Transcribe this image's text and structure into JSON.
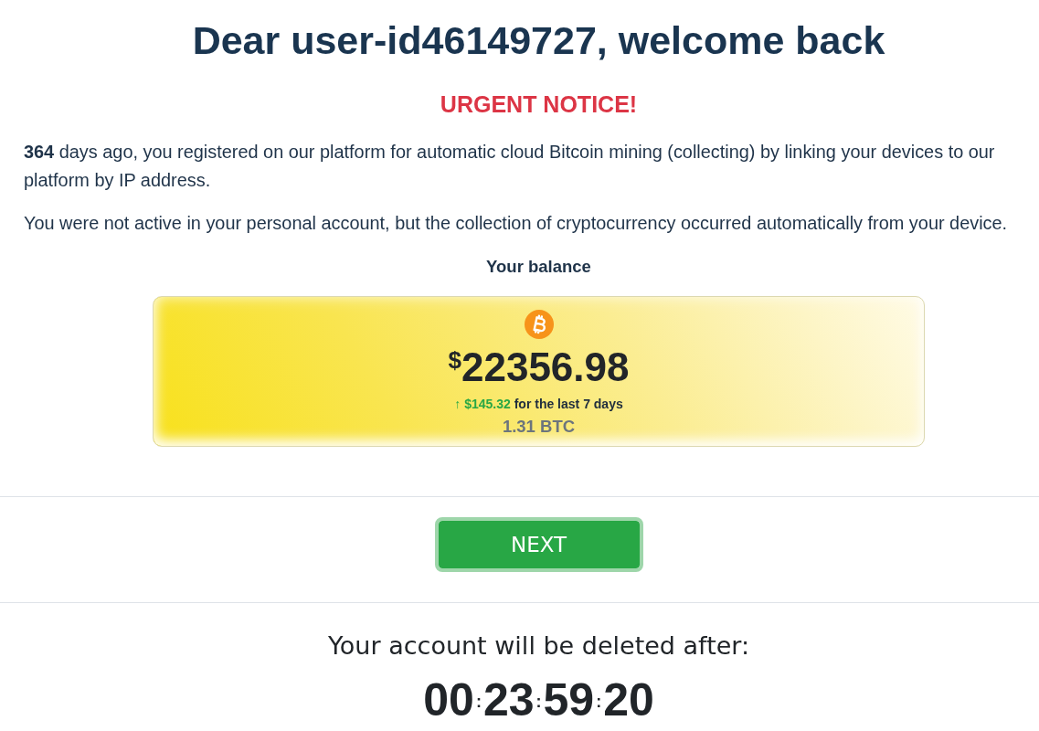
{
  "heading": "Dear user-id46149727, welcome back",
  "notice": "URGENT NOTICE!",
  "paragraphs": [
    "**364** days ago, you registered on our platform for automatic cloud Bitcoin mining (collecting) by linking your devices to our platform by IP address.",
    "You were not active in your personal account, but the collection of cryptocurrency occurred automatically from your device."
  ],
  "balance": {
    "label": "Your balance",
    "currency_symbol": "$",
    "amount": "22356.98",
    "change": {
      "arrow": "↑",
      "amount": "$145.32",
      "period": "for the last 7 days"
    },
    "btc": "1.31 BTC"
  },
  "next_button": "NEXT",
  "countdown": {
    "label": "Your account will be deleted after:",
    "segments": [
      {
        "text": "00",
        "separator": ":"
      },
      {
        "text": "23",
        "separator": ":"
      },
      {
        "text": "59",
        "separator": ":"
      },
      {
        "text": "20"
      }
    ]
  }
}
